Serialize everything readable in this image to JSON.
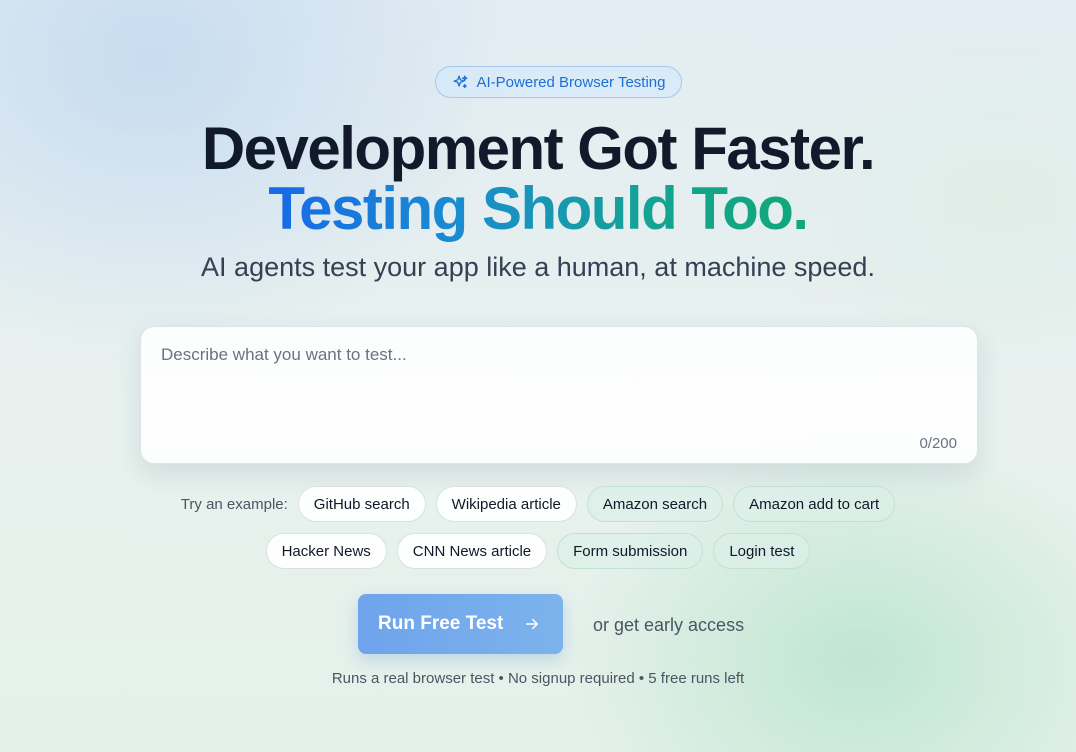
{
  "badge": {
    "label": "AI-Powered Browser Testing",
    "icon": "sparkles-icon"
  },
  "headline": {
    "line1": "Development Got Faster.",
    "line2": "Testing Should Too."
  },
  "subheadline": "AI agents test your app like a human, at machine speed.",
  "prompt": {
    "placeholder": "Describe what you want to test...",
    "value": "",
    "char_count": "0/200"
  },
  "examples": {
    "label": "Try an example:",
    "row1": [
      "GitHub search",
      "Wikipedia article",
      "Amazon search",
      "Amazon add to cart"
    ],
    "row2": [
      "Hacker News",
      "CNN News article",
      "Form submission",
      "Login test"
    ]
  },
  "cta": {
    "run_label": "Run Free Test",
    "run_icon": "arrow-right-icon",
    "early_access_label": "or get early access"
  },
  "footnote": "Runs a real browser test • No signup required • 5 free runs left",
  "colors": {
    "accent_blue": "#1769e8",
    "accent_teal": "#10a878",
    "button": "#74a9ec",
    "badge_text": "#1f6fd0"
  }
}
